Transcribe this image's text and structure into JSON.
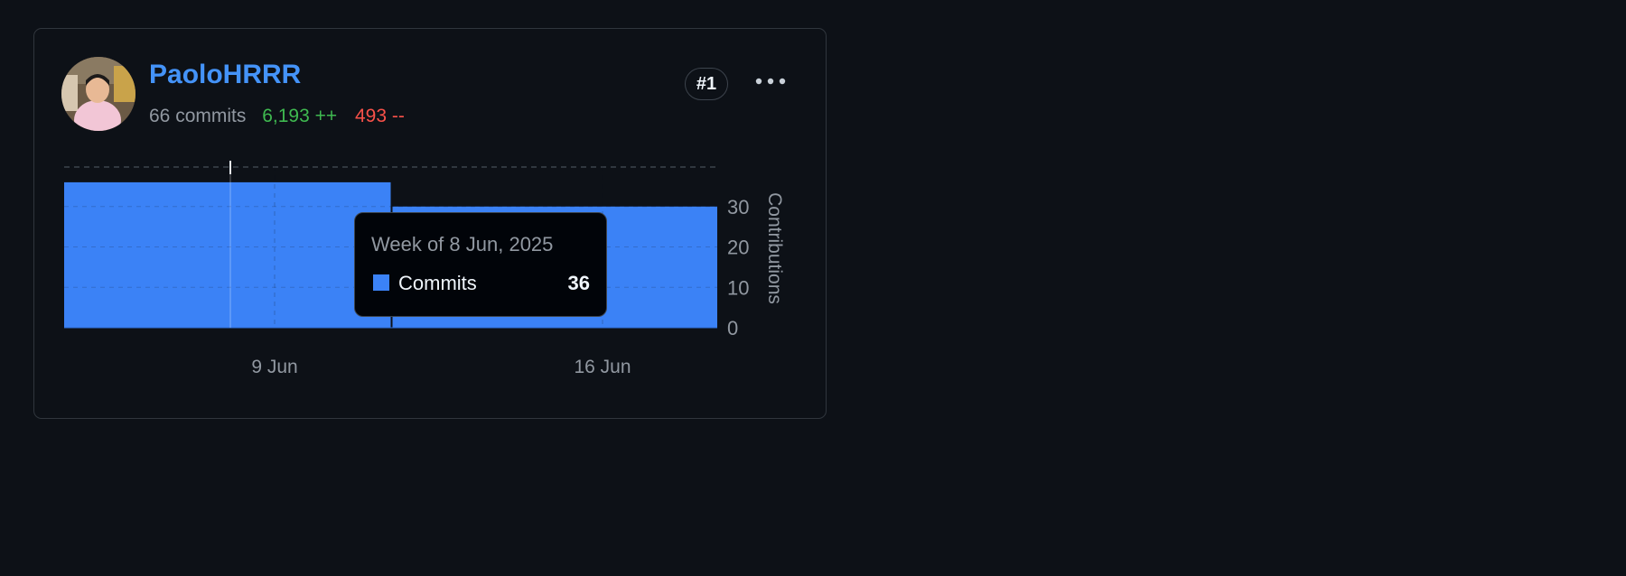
{
  "contributor": {
    "username": "PaoloHRRR",
    "commits_text": "66 commits",
    "additions_text": "6,193 ++",
    "deletions_text": "493 --",
    "rank": "#1",
    "avatar_icon": "user-avatar-photo",
    "more_icon": "kebab-horizontal-icon"
  },
  "colors": {
    "accent": "#4493f8",
    "bar": "#3b82f6",
    "additions": "#3fb950",
    "deletions": "#f85149"
  },
  "chart_data": {
    "type": "bar",
    "x_tick_labels": [
      "9 Jun",
      "16 Jun"
    ],
    "series": [
      {
        "values": [
          36,
          30
        ]
      }
    ],
    "y_ticks": [
      0,
      10,
      20,
      30
    ],
    "ylabel": "Contributions",
    "ylim": [
      0,
      40
    ],
    "grid": true
  },
  "tooltip": {
    "title": "Week of 8 Jun, 2025",
    "series_label": "Commits",
    "value": "36"
  }
}
